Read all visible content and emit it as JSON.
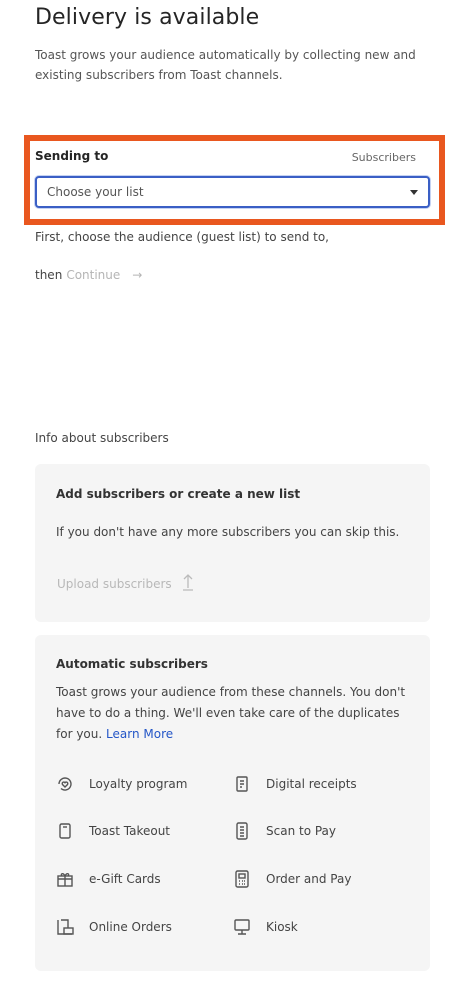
{
  "header": {
    "title": "Delivery is available",
    "intro": "Toast grows your audience automatically by collecting new and existing subscribers from Toast channels."
  },
  "sending": {
    "label": "Sending to",
    "subscribers_label": "Subscribers",
    "select_value": "Choose your list"
  },
  "instructions": {
    "line1": "First, choose the audience (guest list) to send to,",
    "then": "then",
    "continue_label": "Continue",
    "arrow": "→"
  },
  "info": {
    "label": "Info about subscribers",
    "add_card": {
      "title": "Add subscribers or create a new list",
      "text": "If you don't have any more subscribers you can skip this.",
      "upload_label": "Upload subscribers"
    },
    "auto_card": {
      "title": "Automatic subscribers",
      "text": "Toast grows your audience from these channels. You don't have to do a thing. We'll even take care of the duplicates for you.",
      "learn_more": "Learn More",
      "channels": [
        {
          "label": "Loyalty program",
          "icon": "loyalty-icon"
        },
        {
          "label": "Digital receipts",
          "icon": "receipt-icon"
        },
        {
          "label": "Toast Takeout",
          "icon": "takeout-icon"
        },
        {
          "label": "Scan to Pay",
          "icon": "scan-to-pay-icon"
        },
        {
          "label": "e-Gift Cards",
          "icon": "gift-icon"
        },
        {
          "label": "Order and Pay",
          "icon": "order-and-pay-icon"
        },
        {
          "label": "Online Orders",
          "icon": "online-orders-icon"
        },
        {
          "label": "Kiosk",
          "icon": "kiosk-icon"
        }
      ]
    }
  },
  "colors": {
    "highlight": "#e9571f",
    "select_border": "#3a5fc5",
    "link": "#2456c7",
    "card_bg": "#f5f5f5"
  }
}
